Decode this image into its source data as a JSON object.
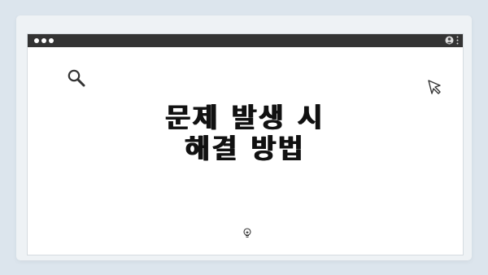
{
  "headline": {
    "line1": "문제 발생 시",
    "line2": "해결 방법"
  },
  "icons": {
    "search": "search-icon",
    "cursor": "cursor-arrow-icon",
    "bulb": "lightbulb-icon",
    "user": "user-icon",
    "menu": "kebab-menu-icon"
  },
  "colors": {
    "background": "#dce5ed",
    "titlebar": "#333333",
    "window": "#ffffff",
    "text": "#111111"
  }
}
